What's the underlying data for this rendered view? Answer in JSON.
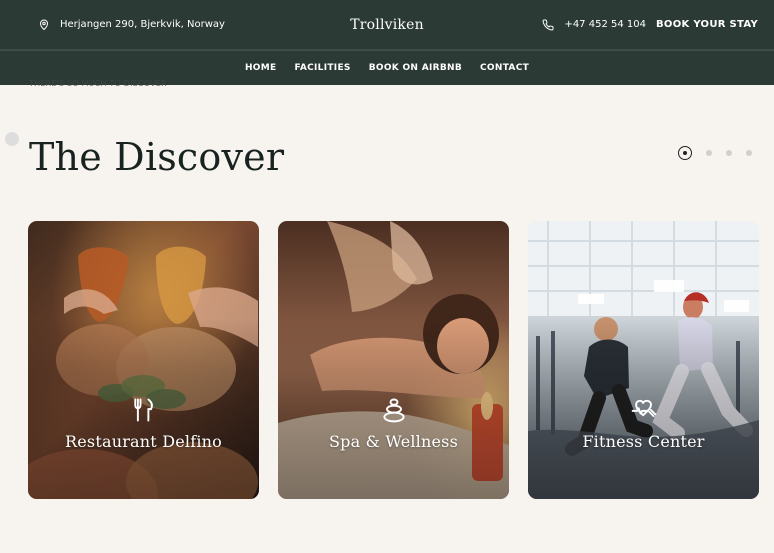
{
  "header": {
    "address": "Herjangen 290, Bjerkvik, Norway",
    "brand": "Trollviken",
    "phone": "+47 452 54 104",
    "book_label": "BOOK YOUR STAY"
  },
  "nav": {
    "items": [
      "HOME",
      "FACILITIES",
      "BOOK ON AIRBNB",
      "CONTACT"
    ]
  },
  "section": {
    "kicker": "THERE'S SO MUCH TO DISCOVER",
    "title": "The Discover"
  },
  "carousel": {
    "active_index": 0,
    "dots": 4
  },
  "cards": [
    {
      "label": "Restaurant Delfino",
      "icon": "cutlery-icon"
    },
    {
      "label": "Spa & Wellness",
      "icon": "spa-stones-icon"
    },
    {
      "label": "Fitness Center",
      "icon": "fitness-heart-icon"
    }
  ],
  "colors": {
    "header_bg": "#2b3a35",
    "page_bg": "#f7f4f0",
    "title_text": "#18221f"
  }
}
